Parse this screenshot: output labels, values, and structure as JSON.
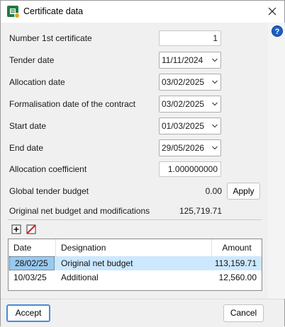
{
  "window": {
    "title": "Certificate data",
    "help_glyph": "?"
  },
  "form": {
    "number_first_certificate": {
      "label": "Number 1st certificate",
      "value": "1"
    },
    "tender_date": {
      "label": "Tender date",
      "value": "11/11/2024"
    },
    "allocation_date": {
      "label": "Allocation date",
      "value": "03/02/2025"
    },
    "formalisation_date": {
      "label": "Formalisation date of the contract",
      "value": "03/02/2025"
    },
    "start_date": {
      "label": "Start date",
      "value": "01/03/2025"
    },
    "end_date": {
      "label": "End date",
      "value": "29/05/2026"
    },
    "allocation_coefficient": {
      "label": "Allocation coefficient",
      "value": "1.000000000"
    },
    "global_tender_budget": {
      "label": "Global tender budget",
      "value": "0.00",
      "apply_label": "Apply"
    },
    "original_net_budget": {
      "label": "Original net budget and modifications",
      "value": "125,719.71"
    }
  },
  "toolbar": {
    "add_icon": "add-row-icon",
    "delete_icon": "delete-row-icon"
  },
  "table": {
    "columns": [
      "Date",
      "Designation",
      "Amount"
    ],
    "rows": [
      {
        "date": "28/02/25",
        "designation": "Original net budget",
        "amount": "113,159.71",
        "selected": true
      },
      {
        "date": "10/03/25",
        "designation": "Additional",
        "amount": "12,560.00",
        "selected": false
      }
    ]
  },
  "footer": {
    "accept_label": "Accept",
    "cancel_label": "Cancel"
  },
  "colors": {
    "selection": "#cce8ff",
    "accent": "#4c8ad8",
    "help": "#1d5fc4"
  }
}
